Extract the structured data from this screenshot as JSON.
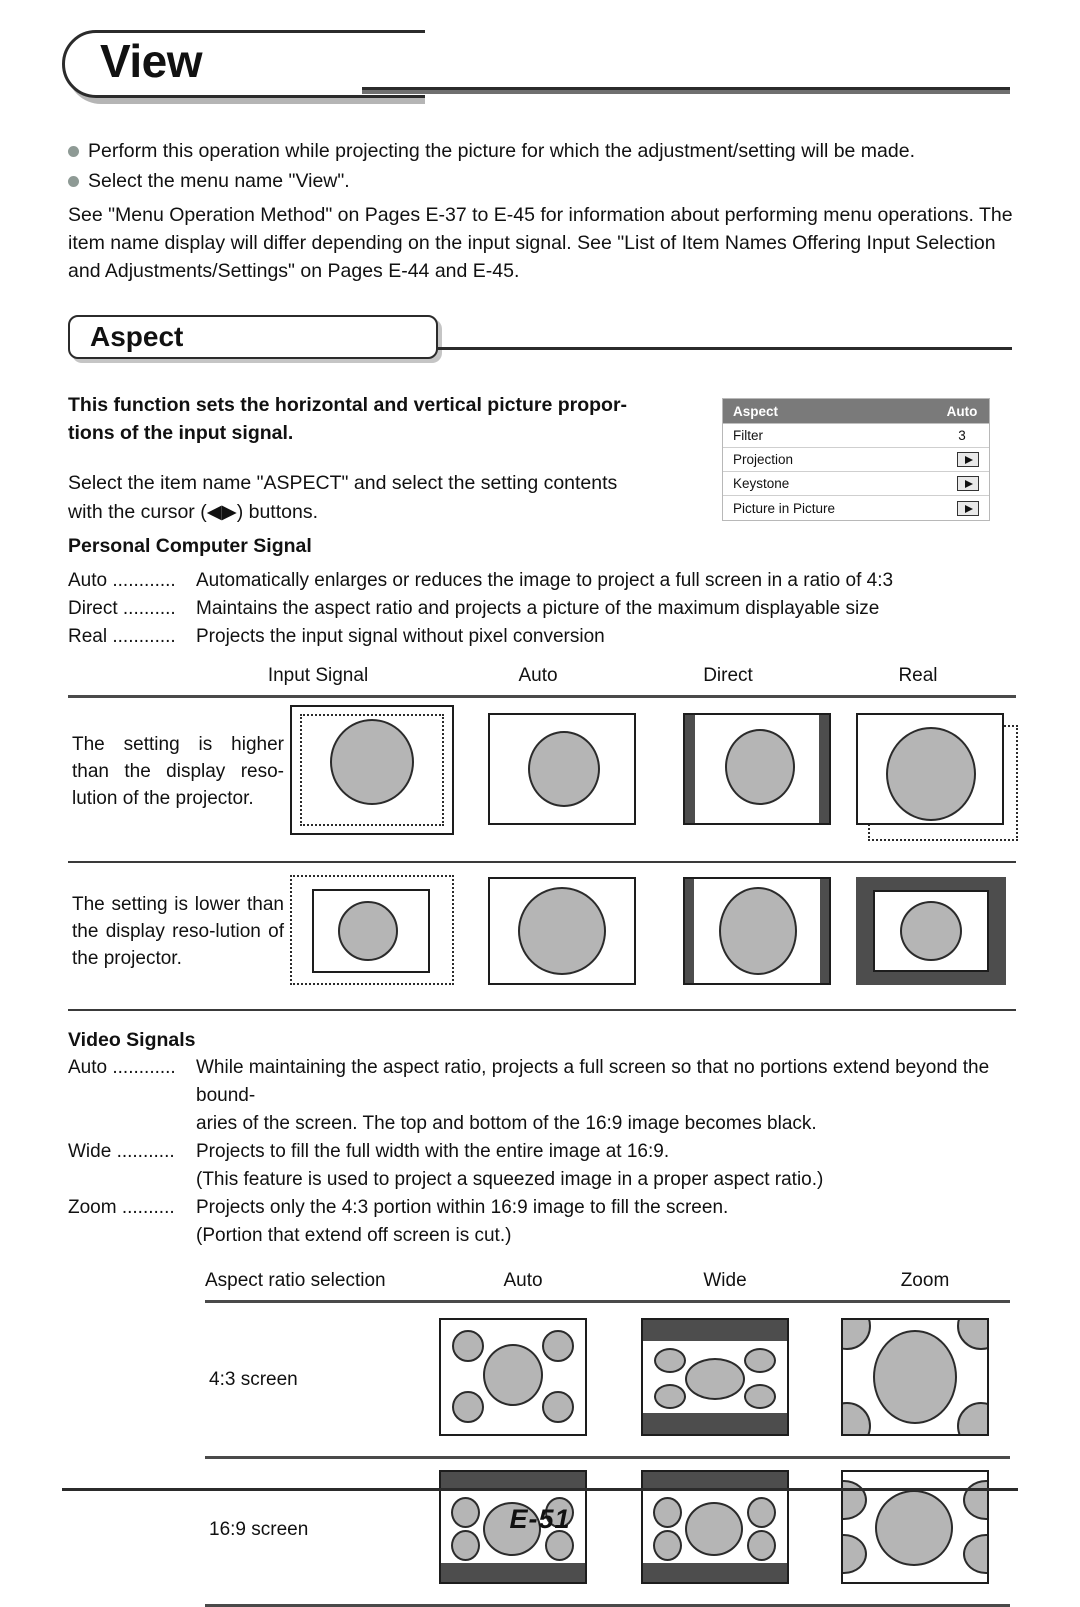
{
  "page": {
    "title": "View",
    "footer_page_number": "E-51"
  },
  "intro": {
    "bullets": [
      "Perform this operation while projecting the picture for which the adjustment/setting will be made.",
      "Select the menu name \"View\"."
    ],
    "paragraph": "See \"Menu Operation Method\" on Pages E-37 to E-45 for information about performing menu operations. The item name display will differ depending on the input signal. See \"List of Item Names Offering Input Selection and Adjustments/Settings\" on Pages E-44 and E-45."
  },
  "section": {
    "heading": "Aspect",
    "lead_bold": "This function sets the horizontal and vertical picture propor-tions of the input signal.",
    "lead_normal_1": "Select the item name \"ASPECT\" and select the setting contents",
    "lead_normal_2": "with the cursor (◀▶) buttons."
  },
  "osd_menu": {
    "rows": [
      {
        "label": "Aspect",
        "value": "Auto",
        "type": "header"
      },
      {
        "label": "Filter",
        "value": "3",
        "type": "value"
      },
      {
        "label": "Projection",
        "value": "",
        "type": "arrow"
      },
      {
        "label": "Keystone",
        "value": "",
        "type": "arrow"
      },
      {
        "label": "Picture in Picture",
        "value": "",
        "type": "arrow"
      }
    ]
  },
  "pc_signal": {
    "heading": "Personal Computer Signal",
    "definitions": [
      {
        "term": "Auto ............",
        "desc": "Automatically enlarges or reduces the image to project a full screen in a ratio of 4:3"
      },
      {
        "term": "Direct ..........",
        "desc": "Maintains the aspect ratio and projects a picture of the maximum displayable size"
      },
      {
        "term": "Real ............",
        "desc": "Projects the input signal without pixel conversion"
      }
    ],
    "columns": [
      "Input Signal",
      "Auto",
      "Direct",
      "Real"
    ],
    "rows": [
      {
        "label": "The setting is higher than the display reso-lution of the projector."
      },
      {
        "label": "The setting is lower than the display reso-lution of the projector."
      }
    ]
  },
  "video_signal": {
    "heading": "Video Signals",
    "definitions": [
      {
        "term": "Auto ............",
        "desc": "While maintaining the aspect ratio, projects a full screen so that no portions extend beyond the bound-",
        "cont": "aries of the screen. The top and bottom of the 16:9 image becomes black."
      },
      {
        "term": "Wide ...........",
        "desc": "Projects to fill the full width with the entire image at 16:9.",
        "cont": "(This feature is used to project a squeezed image in a proper aspect ratio.)"
      },
      {
        "term": "Zoom ..........",
        "desc": "Projects only the 4:3 portion within 16:9 image to fill the screen.",
        "cont": "(Portion that extend off screen is cut.)"
      }
    ],
    "columns": [
      "Aspect ratio selection",
      "Auto",
      "Wide",
      "Zoom"
    ],
    "rows": [
      {
        "label": "4:3 screen"
      },
      {
        "label": "16:9 screen"
      }
    ]
  },
  "colors": {
    "fill_gray": "#b5b5b5",
    "bar_dark": "#4d4d4d",
    "osd_header": "#7a7a7a",
    "bullet": "#8e9a95"
  }
}
